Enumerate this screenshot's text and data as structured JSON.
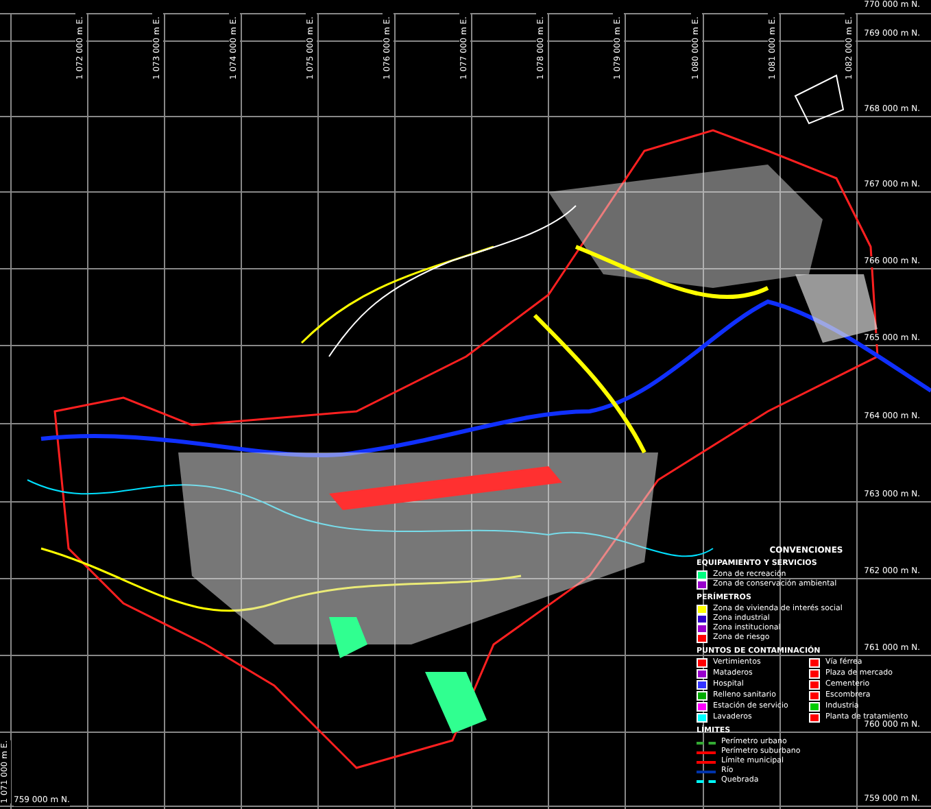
{
  "map": {
    "eastings": [
      "1 072 000 m E.",
      "1 073 000 m E.",
      "1 074 000 m E.",
      "1 075 000 m E.",
      "1 076 000 m E.",
      "1 077 000 m E.",
      "1 078 000 m E.",
      "1 079 000 m E.",
      "1 080 000 m E.",
      "1 081 000 m E.",
      "1 082 000 m E."
    ],
    "northings": [
      "770 000 m N.",
      "769 000 m N.",
      "768 000 m N.",
      "767 000 m N.",
      "766 000 m N.",
      "765 000 m N.",
      "764 000 m N.",
      "763 000 m N.",
      "762 000 m N.",
      "761 000 m N.",
      "760 000 m N.",
      "759 000 m N."
    ],
    "corner_east": "1 071 000 m E.",
    "corner_north": "759 000 m N."
  },
  "legend": {
    "title": "CONVENCIONES",
    "sections": [
      {
        "heading": "EQUIPAMIENTO Y SERVICIOS",
        "items": [
          {
            "kind": "swatch",
            "label": "Zona de recreación",
            "color": "#00ff80"
          },
          {
            "kind": "swatch",
            "label": "Zona de conservación ambiental",
            "color": "#9900cc"
          }
        ]
      },
      {
        "heading": "PERÍMETROS",
        "items": [
          {
            "kind": "swatch",
            "label": "Zona de vivienda de interés social",
            "color": "#ffff00"
          },
          {
            "kind": "swatch",
            "label": "Zona industrial",
            "color": "#3300cc"
          },
          {
            "kind": "swatch",
            "label": "Zona institucional",
            "color": "#9900cc"
          },
          {
            "kind": "swatch",
            "label": "Zona de riesgo",
            "color": "#ff0000"
          }
        ]
      },
      {
        "heading": "PUNTOS DE CONTAMINACIÓN",
        "items": [
          {
            "kind": "swatch",
            "label": "Vertimientos",
            "color": "#ff0000"
          },
          {
            "kind": "swatch",
            "label": "Vía férrea",
            "color": "#ff0000"
          },
          {
            "kind": "swatch",
            "label": "Mataderos",
            "color": "#9900cc"
          },
          {
            "kind": "swatch",
            "label": "Plaza de mercado",
            "color": "#ff0000"
          },
          {
            "kind": "swatch",
            "label": "Hospital",
            "color": "#3333ff"
          },
          {
            "kind": "swatch",
            "label": "Cementerio",
            "color": "#ff0000"
          },
          {
            "kind": "swatch",
            "label": "Relleno sanitario",
            "color": "#00aa00"
          },
          {
            "kind": "swatch",
            "label": "Escombrera",
            "color": "#ff0000"
          },
          {
            "kind": "swatch",
            "label": "Estación de servicio",
            "color": "#ff00ff"
          },
          {
            "kind": "swatch",
            "label": "Industria",
            "color": "#00cc00"
          },
          {
            "kind": "swatch",
            "label": "Lavaderos",
            "color": "#00ffff"
          },
          {
            "kind": "swatch",
            "label": "Planta de tratamiento",
            "color": "#ff0000"
          }
        ]
      },
      {
        "heading": "LÍMITES",
        "items": [
          {
            "kind": "dashed",
            "label": "Perímetro urbano",
            "color": "#33aa33"
          },
          {
            "kind": "line",
            "label": "Perímetro suburbano",
            "color": "#ff0000"
          },
          {
            "kind": "line",
            "label": "Límite municipal",
            "color": "#ff0000"
          },
          {
            "kind": "line",
            "label": "Río",
            "color": "#0033aa"
          },
          {
            "kind": "dashed",
            "label": "Quebrada",
            "color": "#00ffff"
          }
        ]
      }
    ]
  }
}
